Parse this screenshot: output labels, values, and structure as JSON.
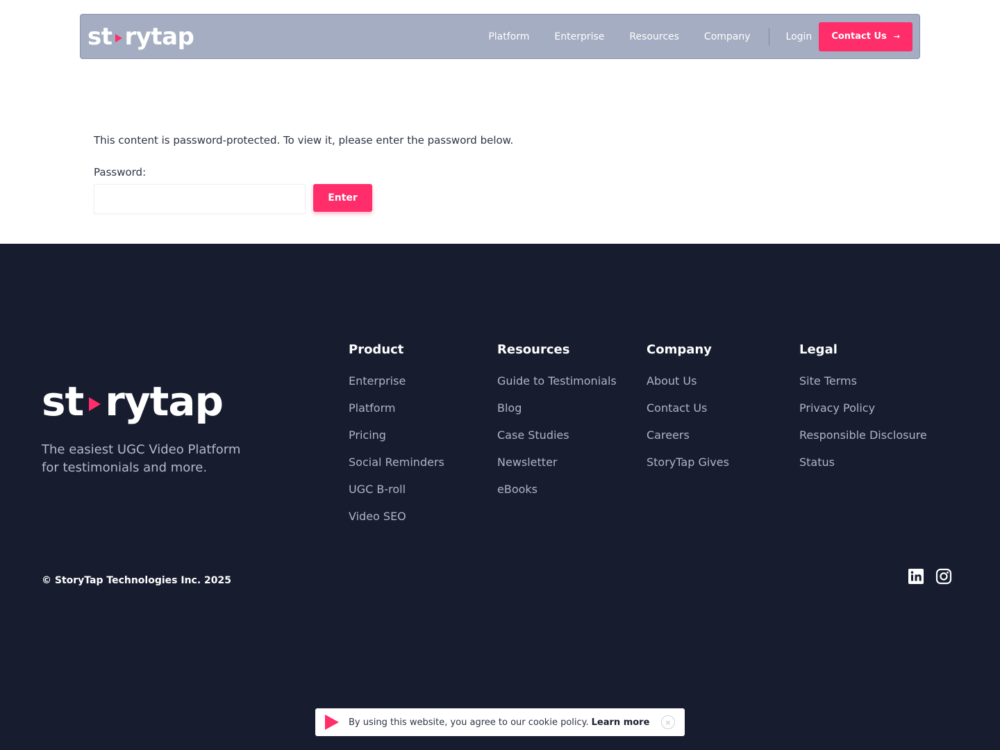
{
  "header": {
    "logo_left": "st",
    "logo_right": "rytap",
    "nav": [
      "Platform",
      "Enterprise",
      "Resources",
      "Company"
    ],
    "login": "Login",
    "contact": "Contact Us",
    "contact_arrow": "→"
  },
  "main": {
    "protected_message": "This content is password-protected. To view it, please enter the password below.",
    "password_label": "Password:",
    "password_value": "",
    "enter_label": "Enter"
  },
  "footer": {
    "logo_left": "st",
    "logo_right": "rytap",
    "tagline": "The easiest UGC Video Platform for testimonials and more.",
    "columns": [
      {
        "title": "Product",
        "links": [
          "Enterprise",
          "Platform",
          "Pricing",
          "Social Reminders",
          "UGC B-roll",
          "Video SEO"
        ]
      },
      {
        "title": "Resources",
        "links": [
          "Guide to Testimonials",
          "Blog",
          "Case Studies",
          "Newsletter",
          "eBooks"
        ]
      },
      {
        "title": "Company",
        "links": [
          "About Us",
          "Contact Us",
          "Careers",
          "StoryTap Gives"
        ]
      },
      {
        "title": "Legal",
        "links": [
          "Site Terms",
          "Privacy Policy",
          "Responsible Disclosure",
          "Status"
        ]
      }
    ],
    "copyright": "© StoryTap Technologies Inc. 2025",
    "social_icons": [
      "linkedin-icon",
      "instagram-icon"
    ]
  },
  "cookie": {
    "message": "By using this website, you agree to our cookie policy.",
    "learn_more": "Learn more",
    "close_glyph": "×"
  },
  "colors": {
    "accent": "#ff2d6a",
    "header_bg": "#a4adc2",
    "footer_bg": "#171c2f"
  }
}
